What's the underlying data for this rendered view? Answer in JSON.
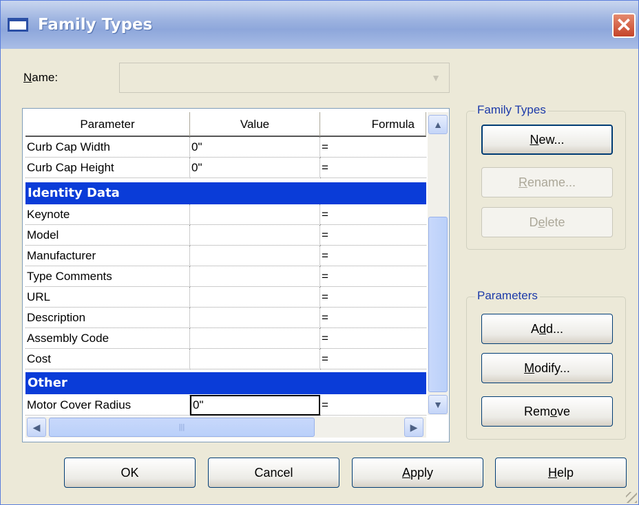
{
  "window": {
    "title": "Family Types",
    "close_glyph": "✕"
  },
  "name_field": {
    "label_letter": "N",
    "label_rest": "ame:",
    "value": ""
  },
  "grid": {
    "headers": [
      "Parameter",
      "Value",
      "Formula"
    ],
    "rows_top": [
      {
        "param": "Curb Cap Width",
        "value": "0\"",
        "formula": "="
      },
      {
        "param": "Curb Cap Height",
        "value": "0\"",
        "formula": "="
      }
    ],
    "group_identity": "Identity Data",
    "rows_identity": [
      {
        "param": "Keynote",
        "value": "",
        "formula": "="
      },
      {
        "param": "Model",
        "value": "",
        "formula": "="
      },
      {
        "param": "Manufacturer",
        "value": "",
        "formula": "="
      },
      {
        "param": "Type Comments",
        "value": "",
        "formula": "="
      },
      {
        "param": "URL",
        "value": "",
        "formula": "="
      },
      {
        "param": "Description",
        "value": "",
        "formula": "="
      },
      {
        "param": "Assembly Code",
        "value": "",
        "formula": "="
      },
      {
        "param": "Cost",
        "value": "",
        "formula": "="
      }
    ],
    "group_other": "Other",
    "rows_other": [
      {
        "param": "Motor Cover Radius",
        "value": "0\"",
        "formula": "="
      }
    ]
  },
  "family_types_group": {
    "title": "Family Types",
    "new_btn": {
      "u": "N",
      "rest": "ew..."
    },
    "rename_btn": {
      "u": "R",
      "rest": "ename..."
    },
    "delete_btn": {
      "pre": "D",
      "u": "e",
      "rest": "lete"
    }
  },
  "parameters_group": {
    "title": "Parameters",
    "add_btn": {
      "pre": "A",
      "u": "d",
      "rest": "d..."
    },
    "modify_btn": {
      "u": "M",
      "rest": "odify..."
    },
    "remove_btn": {
      "pre": "Rem",
      "u": "o",
      "rest": "ve"
    }
  },
  "footer": {
    "ok": "OK",
    "cancel": "Cancel",
    "apply_btn": {
      "u": "A",
      "rest": "pply"
    },
    "help_btn": {
      "u": "H",
      "rest": "elp"
    }
  },
  "icons": [
    "window-icon",
    "close-icon",
    "dropdown-arrow-icon",
    "scroll-up-icon",
    "scroll-down-icon",
    "scroll-left-icon",
    "scroll-right-icon",
    "resize-grip-icon"
  ]
}
